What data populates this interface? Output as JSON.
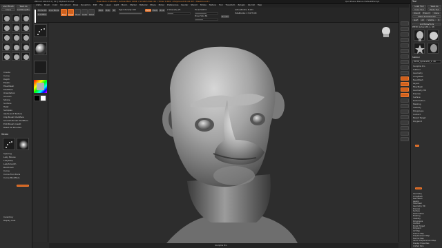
{
  "titlebar": {
    "app_text": "ZBrush 2022.0.1 [ Sk ] Stylized Sculpt ",
    "status_text": "Free Mem 2.934GB • Active Mem 1034 • Scratch Disk 46 • Timer 0.001 • PolyCount 8.141 KP • MeshCount 1",
    "right_text": "QuickSave   Menus   DefaultZScript"
  },
  "menubar": {
    "items": [
      "Alpha",
      "Brush",
      "Color",
      "Document",
      "Draw",
      "Dynamics",
      "Edit",
      "File",
      "Layer",
      "Light",
      "Macro",
      "Marker",
      "Material",
      "Movie",
      "Picker",
      "Preferences",
      "Render",
      "Stencil",
      "Stroke",
      "Texture",
      "Tool",
      "Transform",
      "Zplugin",
      "Zscript",
      "Help"
    ]
  },
  "toolbar": {
    "home_page": "Home Page",
    "lightbox": "LightBox",
    "live_boolean": "Live Boolean",
    "edit": "Edit",
    "draw": "Draw",
    "move": "Move",
    "scale": "Scale",
    "rotate": "Rotate",
    "mrgb": "Mrgb",
    "rgb": "Rgb",
    "m": "M",
    "zadd": "Zadd",
    "zsub": "Zsub",
    "zcut": "Zcut",
    "focal_shift_label": "Focal Shift 0",
    "focal_shift_value": 0.5,
    "draw_size_label": "Draw Size 64",
    "draw_size_value": 0.35,
    "rgb_intensity_label": "Rgb Intensity 100",
    "z_intensity_label": "Z Intensity 25",
    "z_intensity_value": 0.25,
    "dynamic": "Dynamic",
    "active_points": "ActivePoints: 8,141",
    "total_points": "TotalPoints: 17.673 Mil"
  },
  "left_panel": {
    "brush_title": "Brush",
    "load_brush": "Load Brush",
    "save_as": "Save As",
    "clone": "Clone",
    "lightbox_brushes": "Lightbox▸Brushes",
    "menu_items": [
      "Create",
      "Curve",
      "Depth",
      "Elastic",
      "FiberMesh",
      "Modifiers",
      "Orientation",
      "Smooth",
      "Stroke",
      "Surface",
      "Twist",
      "Samples",
      "Alpha and Texture",
      "Clip Brush Modifiers",
      "Smooth Brush Modifiers",
      "Edit Brush Credit",
      "Reset All Brushes"
    ],
    "stroke_title": "Stroke",
    "stroke_items": [
      "Spacing",
      "Lazy Mouse",
      "LazyStep",
      "LazySmooth",
      "Backtrack",
      "Curve",
      "Curve Functions",
      "Curve Modifiers"
    ],
    "bottom_items": [
      "Inventory",
      "Replay Last"
    ]
  },
  "right_panel": {
    "tool_title": "Tool",
    "load_tool": "Load Tool",
    "save_as": "Save As",
    "copy_tool": "Copy Tool",
    "paste_tool": "Paste Tool",
    "import": "Import",
    "export": "Export",
    "clone": "Clone",
    "make_polymesh": "Make PolyMesh3D",
    "goz": "GoZ",
    "all": "All",
    "visible": "Visible",
    "r": "R",
    "lightbox_tools": "Lightbox▸Tools",
    "tool_name": "PM3D_Sphere3D_1. 48",
    "subtool": "Subtool",
    "sections": [
      "Geometry",
      "ArrayMesh",
      "NanoMesh",
      "Layers",
      "FiberMesh",
      "Geometry HD",
      "Preview",
      "Surface",
      "Deformation",
      "Masking",
      "Visibility",
      "Polygroups",
      "Contact",
      "Morph Target",
      "Polypaint",
      "UV Map",
      "Texture Map",
      "Displacement Map",
      "Normal Map",
      "Vector Displacement Map",
      "Display Properties",
      "Unified Skin"
    ],
    "upper_sections": [
      "Sculptris Pro",
      "Subtool",
      "Geometry",
      "ArrayMesh",
      "NanoMesh",
      "Layers",
      "FiberMesh",
      "Geometry HD",
      "Preview",
      "Surface",
      "Deformation",
      "Masking",
      "Visibility",
      "Polygroups",
      "Contact",
      "Morph Target",
      "Polypaint"
    ]
  },
  "colors": {
    "accent": "#d0601c",
    "panel": "#2f2f2f",
    "viewport": "#2d2d2d",
    "clay": "#9a9a9a"
  },
  "status": {
    "bottom_text": "Sculptris Pro"
  }
}
